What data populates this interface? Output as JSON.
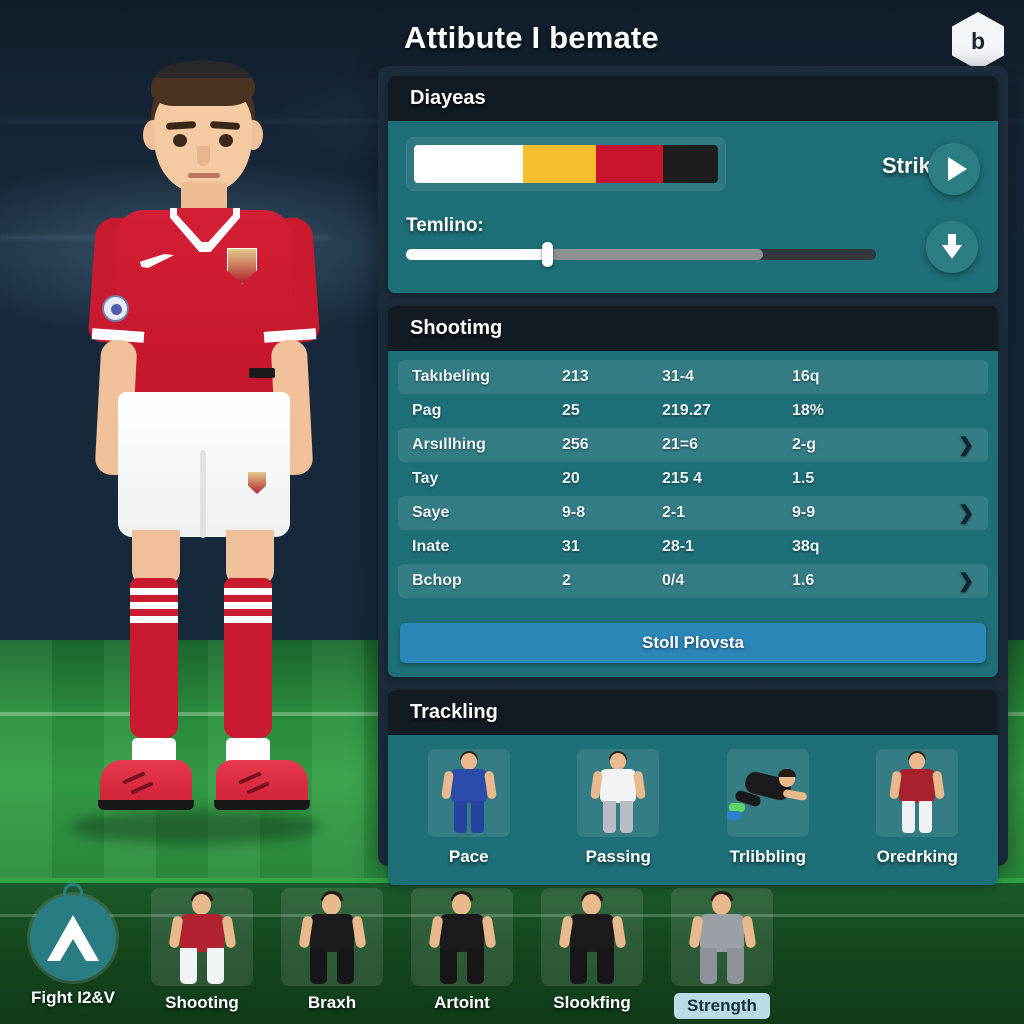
{
  "header": {
    "title": "Attibute I bemate",
    "badge_glyph": "b",
    "badge_name": "hex-badge"
  },
  "diagnostics": {
    "header": "Diayeas",
    "role_label": "Strikee.",
    "slider_label": "Temlino:",
    "segments": [
      {
        "name": "segment-white",
        "color": "#ffffff",
        "pct": 36
      },
      {
        "name": "segment-yellow",
        "color": "#f5be2e",
        "pct": 24
      },
      {
        "name": "segment-red",
        "color": "#c8152b",
        "pct": 22
      },
      {
        "name": "segment-black",
        "color": "#1d1d1f",
        "pct": 18
      }
    ],
    "slider": {
      "value_pct": 30,
      "mid_pct": 76
    },
    "play_icon": "play-icon",
    "download_icon": "download-icon"
  },
  "stats": {
    "header": "Shootimg",
    "rows": [
      {
        "label": "Takıbeling",
        "c1": "213",
        "c2": "31-4",
        "c3": "16q",
        "chevron": false,
        "alt": true
      },
      {
        "label": "Pag",
        "c1": "25",
        "c2": "219.27",
        "c3": "18%",
        "chevron": false,
        "alt": false
      },
      {
        "label": "Arsıllhing",
        "c1": "256",
        "c2": "21=6",
        "c3": "2-g",
        "chevron": true,
        "alt": true
      },
      {
        "label": "Tay",
        "c1": "20",
        "c2": "215 4",
        "c3": "1.5",
        "chevron": false,
        "alt": false
      },
      {
        "label": "Saye",
        "c1": "9-8",
        "c2": "2-1",
        "c3": "9-9",
        "chevron": true,
        "alt": true
      },
      {
        "label": "Inate",
        "c1": "31",
        "c2": "28-1",
        "c3": "38q",
        "chevron": false,
        "alt": false
      },
      {
        "label": "Bchop",
        "c1": "2",
        "c2": "0/4",
        "c3": "1.6",
        "chevron": true,
        "alt": true
      }
    ],
    "button_label": "Stoll Plovsta",
    "chevron_glyph": "❯"
  },
  "tracking": {
    "header": "Trackling",
    "cards": [
      {
        "label": "Pace",
        "kit": "#2d4ba8",
        "shorts": "#2743a0",
        "icon": "player-blue-icon"
      },
      {
        "label": "Passing",
        "kit": "#f2f3f5",
        "shorts": "#b9bcc2",
        "icon": "player-white-icon"
      },
      {
        "label": "Trlibbling",
        "kit": "#1b1b1d",
        "shorts": "#19191b",
        "icon": "player-diving-icon"
      },
      {
        "label": "Oredrking",
        "kit": "#a8212f",
        "shorts": "#f0f1f3",
        "icon": "player-red-icon"
      }
    ]
  },
  "bottom_nav": {
    "logo": {
      "label": "Fight I2&V",
      "icon": "triangle-a-logo"
    },
    "items": [
      {
        "label": "Shooting",
        "kit": "#b32230",
        "shorts": "#f2f3f5",
        "legs": "#b32230",
        "selected": false
      },
      {
        "label": "Braxh",
        "kit": "#1b1b1d",
        "shorts": "#17171a",
        "legs": "#17171a",
        "selected": false
      },
      {
        "label": "Artoint",
        "kit": "#1b1b1d",
        "shorts": "#17171a",
        "legs": "#17171a",
        "selected": false
      },
      {
        "label": "Slookfing",
        "kit": "#1b1b1d",
        "shorts": "#17171a",
        "legs": "#17171a",
        "selected": false
      },
      {
        "label": "Strength",
        "kit": "#9aa0a6",
        "shorts": "#8c9297",
        "legs": "#8c9297",
        "selected": true
      }
    ]
  },
  "theme": {
    "panel_bg": "#1d2c3b",
    "card_teal": "#1e6f78",
    "header_dark": "#121a22",
    "accent_blue": "#2b87b8",
    "selected_pill": "#b9dce7"
  }
}
